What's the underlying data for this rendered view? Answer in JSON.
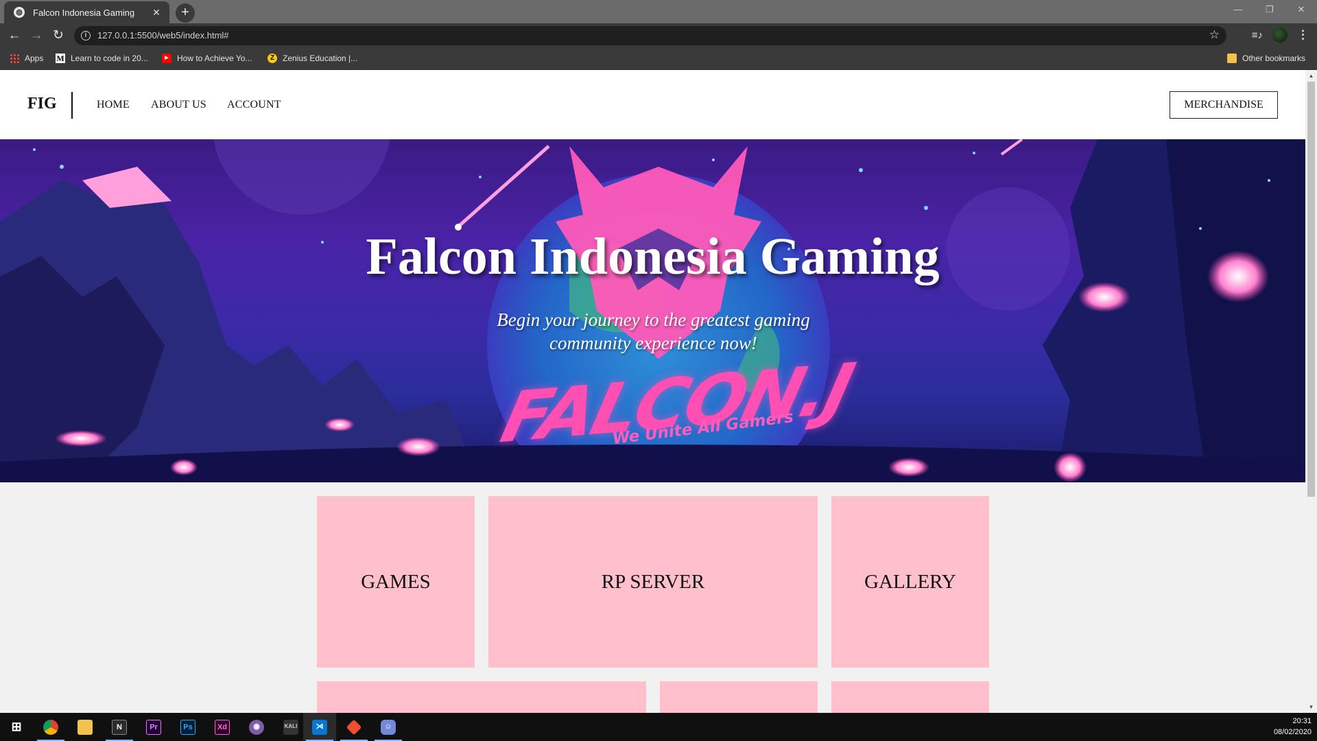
{
  "browser": {
    "tab_title": "Falcon Indonesia Gaming",
    "tab_close": "✕",
    "new_tab": "+",
    "window_controls": [
      "—",
      "❐",
      "✕"
    ],
    "url": "127.0.0.1:5500/web5/index.html#",
    "bookmarks": [
      {
        "label": "Apps",
        "icon": "apps-grid-icon"
      },
      {
        "label": "Learn to code in 20...",
        "icon": "medium-icon"
      },
      {
        "label": "How to Achieve Yo...",
        "icon": "youtube-icon"
      },
      {
        "label": "Zenius Education |...",
        "icon": "zenius-icon"
      }
    ],
    "other_bookmarks": "Other bookmarks"
  },
  "site": {
    "brand": "FIG",
    "nav": [
      "HOME",
      "ABOUT US",
      "ACCOUNT"
    ],
    "merch_button": "MERCHANDISE",
    "hero": {
      "title": "Falcon Indonesia Gaming",
      "subtitle": "Begin your journey to the greatest gaming community experience now!",
      "logo_text": "FALCON.J",
      "logo_tagline": "We Unite All Gamers"
    },
    "tiles": [
      "GAMES",
      "RP SERVER",
      "GALLERY"
    ],
    "colors": {
      "tile": "#ffc0cb",
      "hero_accent": "#ff4fb3",
      "hero_bg": "#3b1a84"
    }
  },
  "taskbar": {
    "apps": [
      "windows-start-icon",
      "chrome-icon",
      "file-explorer-icon",
      "notion-icon",
      "premiere-icon",
      "photoshop-icon",
      "xd-icon",
      "github-desktop-icon",
      "kali-icon",
      "vscode-icon",
      "git-icon",
      "discord-icon"
    ],
    "time": "20:31",
    "date": "08/02/2020"
  }
}
